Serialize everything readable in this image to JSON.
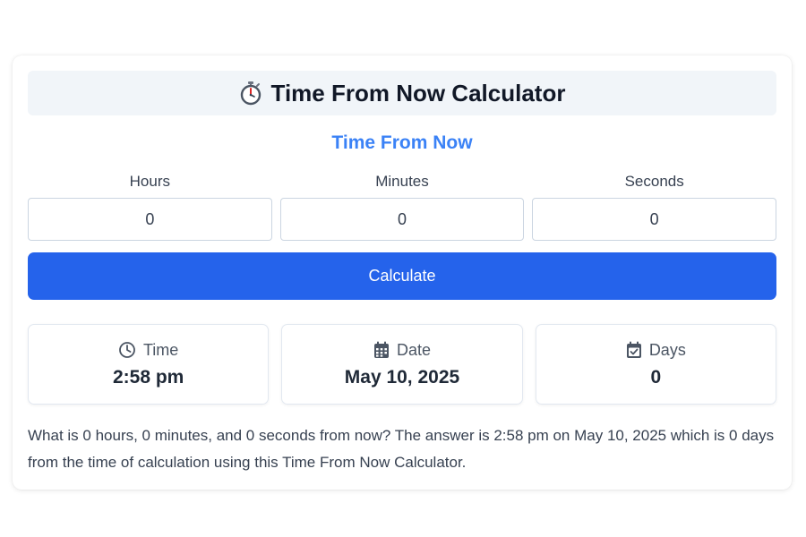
{
  "header": {
    "title": "Time From Now Calculator",
    "icon": "stopwatch-icon"
  },
  "subtitle": "Time From Now",
  "colors": {
    "accent": "#3b82f6",
    "button": "#2563eb",
    "header_bg": "#f1f5f9"
  },
  "fields": {
    "hours": {
      "label": "Hours",
      "value": "0"
    },
    "minutes": {
      "label": "Minutes",
      "value": "0"
    },
    "seconds": {
      "label": "Seconds",
      "value": "0"
    }
  },
  "calculate_label": "Calculate",
  "results": {
    "time": {
      "label": "Time",
      "value": "2:58 pm",
      "icon": "clock-icon"
    },
    "date": {
      "label": "Date",
      "value": "May 10, 2025",
      "icon": "calendar-icon"
    },
    "days": {
      "label": "Days",
      "value": "0",
      "icon": "calendar-check-icon"
    }
  },
  "description": "What is 0 hours, 0 minutes, and 0 seconds from now? The answer is 2:58 pm on May 10, 2025 which is 0 days from the time of calculation using this Time From Now Calculator."
}
